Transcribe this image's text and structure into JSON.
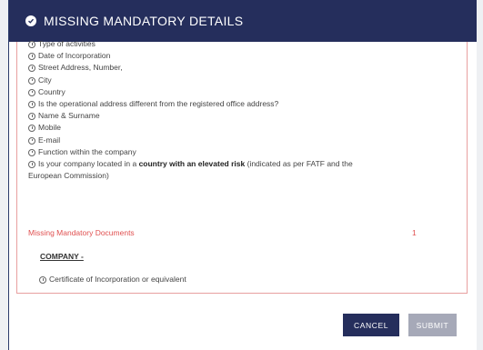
{
  "modal": {
    "title": "MISSING MANDATORY DETAILS",
    "items": [
      "Type of activities",
      "Date of Incorporation",
      "Street Address, Number,",
      "City",
      "Country",
      "Is the operational address different from the registered office address?",
      "Name & Surname",
      "Mobile",
      "E-mail",
      "Function within the company"
    ],
    "risk_item": {
      "prefix": "Is your company located in a ",
      "bold": "country with an elevated risk",
      "suffix": " (indicated as per FATF and the",
      "continuation": "European Commission)"
    },
    "documents": {
      "label": "Missing Mandatory Documents",
      "count": "1",
      "section_title": "COMPANY -",
      "items": [
        "Certificate of Incorporation or equivalent"
      ]
    },
    "buttons": {
      "cancel": "CANCEL",
      "submit": "SUBMIT"
    }
  }
}
